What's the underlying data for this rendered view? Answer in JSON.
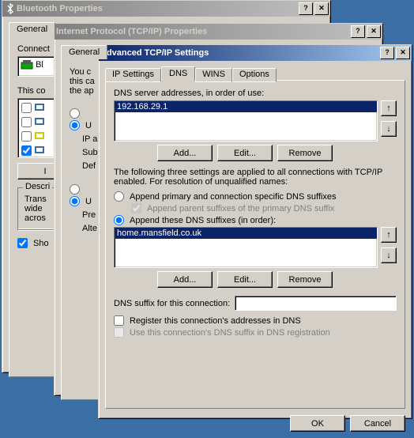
{
  "win1": {
    "title": "Bluetooth Properties",
    "tabs": [
      "General"
    ],
    "connect_label": "Connect",
    "bl_label": "Bl",
    "this_label": "This co",
    "show": "Sho",
    "desc_title": "Descri",
    "desc1": "Trans",
    "desc2": "wide",
    "desc3": "acros"
  },
  "win2": {
    "title": "Internet Protocol (TCP/IP) Properties",
    "tabs": [
      "General"
    ],
    "l1": "You c",
    "l2": "this ca",
    "l3": "the ap",
    "ip": "IP a",
    "sub": "Sub",
    "def": "Def",
    "pre": "Pre",
    "alt": "Alte"
  },
  "win3": {
    "title": "Advanced TCP/IP Settings",
    "tabs": {
      "ip": "IP Settings",
      "dns": "DNS",
      "wins": "WINS",
      "options": "Options"
    },
    "dns_servers_label": "DNS server addresses, in order of use:",
    "dns_server_entry": "192.168.29.1",
    "add": "Add...",
    "edit": "Edit...",
    "remove": "Remove",
    "three_label": "The following three settings are applied to all connections with TCP/IP enabled. For resolution of unqualified names:",
    "r1": "Append primary and connection specific DNS suffixes",
    "r1a": "Append parent suffixes of the primary DNS suffix",
    "r2": "Append these DNS suffixes (in order):",
    "suffix_entry": "home.mansfield.co.uk",
    "suffix_label": "DNS suffix for this connection:",
    "cb1": "Register this connection's addresses in DNS",
    "cb2": "Use this connection's DNS suffix in DNS registration",
    "ok": "OK",
    "cancel": "Cancel"
  }
}
